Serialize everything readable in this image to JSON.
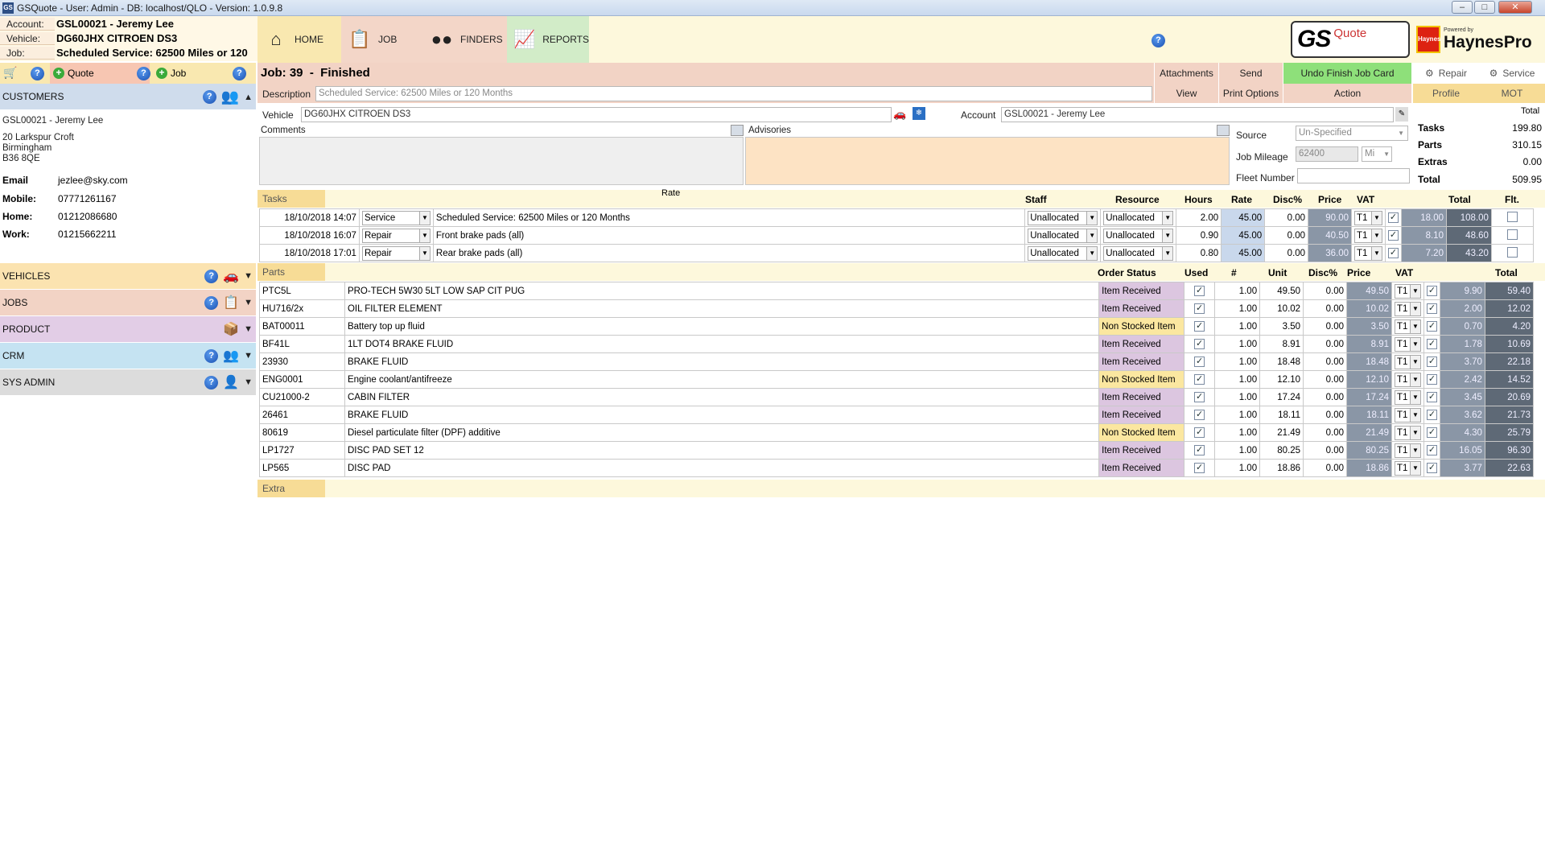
{
  "window": {
    "title": "GSQuote - User: Admin - DB: localhost/QLO - Version: 1.0.9.8"
  },
  "info": {
    "account_label": "Account:",
    "account_value": "GSL00021 - Jeremy Lee",
    "vehicle_label": "Vehicle:",
    "vehicle_value": "DG60JHX CITROEN DS3",
    "job_label": "Job:",
    "job_value": "Scheduled Service: 62500 Miles or 120"
  },
  "nav": {
    "home": "HOME",
    "job": "JOB",
    "finders": "FINDERS",
    "reports": "REPORTS"
  },
  "brand": {
    "gs": "GS",
    "quote": "Quote",
    "powered": "Powered by",
    "haynes": "HaynesPro",
    "haynes_logo": "Haynes"
  },
  "toolbar": {
    "quote": "Quote",
    "job": "Job"
  },
  "sidebar": {
    "customers": "CUSTOMERS",
    "vehicles": "VEHICLES",
    "jobs": "JOBS",
    "product": "PRODUCT",
    "crm": "CRM",
    "sysadmin": "SYS ADMIN"
  },
  "customer": {
    "name": "GSL00021 - Jeremy Lee",
    "addr1": "20 Larkspur Croft",
    "addr2": "Birmingham",
    "addr3": "B36 8QE",
    "email_label": "Email",
    "email": "jezlee@sky.com",
    "mobile_label": "Mobile:",
    "mobile": "07771261167",
    "home_label": "Home:",
    "home": "01212086680",
    "work_label": "Work:",
    "work": "01215662211"
  },
  "job": {
    "title": "Job: 39  -  Finished",
    "attachments": "Attachments",
    "send": "Send",
    "undo": "Undo Finish Job Card",
    "view": "View",
    "print_options": "Print Options",
    "action": "Action",
    "repair": "Repair",
    "service": "Service",
    "profile": "Profile",
    "mot": "MOT",
    "description_label": "Description",
    "description": "Scheduled Service: 62500 Miles or 120 Months",
    "vehicle_label": "Vehicle",
    "vehicle": "DG60JHX CITROEN DS3",
    "account_label": "Account",
    "account": "GSL00021 - Jeremy Lee",
    "comments_label": "Comments",
    "advisories_label": "Advisories",
    "source_label": "Source",
    "source": "Un-Specified",
    "mileage_label": "Job Mileage",
    "mileage": "62400",
    "mileage_unit": "Mi",
    "fleet_label": "Fleet Number",
    "fleet": ""
  },
  "totals": {
    "header": "Total",
    "tasks_label": "Tasks",
    "tasks": "199.80",
    "parts_label": "Parts",
    "parts": "310.15",
    "extras_label": "Extras",
    "extras": "0.00",
    "total_label": "Total",
    "total": "509.95"
  },
  "tasks": {
    "section": "Tasks",
    "rate_top": "Rate",
    "headers": {
      "staff": "Staff",
      "resource": "Resource",
      "hours": "Hours",
      "rate": "Rate",
      "disc": "Disc%",
      "price": "Price",
      "vat": "VAT",
      "total": "Total",
      "flt": "Flt."
    },
    "rows": [
      {
        "date": "18/10/2018 14:07",
        "type": "Service",
        "desc": "Scheduled Service: 62500 Miles or 120 Months",
        "staff": "Unallocated",
        "resource": "Unallocated",
        "hours": "2.00",
        "rate": "45.00",
        "disc": "0.00",
        "price": "90.00",
        "vat": "T1",
        "vatamt": "18.00",
        "total": "108.00"
      },
      {
        "date": "18/10/2018 16:07",
        "type": "Repair",
        "desc": "Front brake pads (all)",
        "staff": "Unallocated",
        "resource": "Unallocated",
        "hours": "0.90",
        "rate": "45.00",
        "disc": "0.00",
        "price": "40.50",
        "vat": "T1",
        "vatamt": "8.10",
        "total": "48.60"
      },
      {
        "date": "18/10/2018 17:01",
        "type": "Repair",
        "desc": "Rear brake pads (all)",
        "staff": "Unallocated",
        "resource": "Unallocated",
        "hours": "0.80",
        "rate": "45.00",
        "disc": "0.00",
        "price": "36.00",
        "vat": "T1",
        "vatamt": "7.20",
        "total": "43.20"
      }
    ]
  },
  "parts": {
    "section": "Parts",
    "headers": {
      "status": "Order Status",
      "used": "Used",
      "qty": "#",
      "unit": "Unit",
      "disc": "Disc%",
      "price": "Price",
      "vat": "VAT",
      "total": "Total"
    },
    "rows": [
      {
        "code": "PTC5L",
        "desc": "PRO-TECH 5W30 5LT LOW SAP CIT  PUG",
        "status": "Item Received",
        "qty": "1.00",
        "unit": "49.50",
        "disc": "0.00",
        "price": "49.50",
        "vat": "T1",
        "vatamt": "9.90",
        "total": "59.40"
      },
      {
        "code": "HU716/2x",
        "desc": "OIL FILTER ELEMENT",
        "status": "Item Received",
        "qty": "1.00",
        "unit": "10.02",
        "disc": "0.00",
        "price": "10.02",
        "vat": "T1",
        "vatamt": "2.00",
        "total": "12.02"
      },
      {
        "code": "BAT00011",
        "desc": "Battery top up fluid",
        "status": "Non Stocked Item",
        "qty": "1.00",
        "unit": "3.50",
        "disc": "0.00",
        "price": "3.50",
        "vat": "T1",
        "vatamt": "0.70",
        "total": "4.20"
      },
      {
        "code": "BF41L",
        "desc": "1LT DOT4 BRAKE FLUID",
        "status": "Item Received",
        "qty": "1.00",
        "unit": "8.91",
        "disc": "0.00",
        "price": "8.91",
        "vat": "T1",
        "vatamt": "1.78",
        "total": "10.69"
      },
      {
        "code": "23930",
        "desc": "BRAKE FLUID",
        "status": "Item Received",
        "qty": "1.00",
        "unit": "18.48",
        "disc": "0.00",
        "price": "18.48",
        "vat": "T1",
        "vatamt": "3.70",
        "total": "22.18"
      },
      {
        "code": "ENG0001",
        "desc": "Engine coolant/antifreeze",
        "status": "Non Stocked Item",
        "qty": "1.00",
        "unit": "12.10",
        "disc": "0.00",
        "price": "12.10",
        "vat": "T1",
        "vatamt": "2.42",
        "total": "14.52"
      },
      {
        "code": "CU21000-2",
        "desc": "CABIN FILTER",
        "status": "Item Received",
        "qty": "1.00",
        "unit": "17.24",
        "disc": "0.00",
        "price": "17.24",
        "vat": "T1",
        "vatamt": "3.45",
        "total": "20.69"
      },
      {
        "code": "26461",
        "desc": "BRAKE FLUID",
        "status": "Item Received",
        "qty": "1.00",
        "unit": "18.11",
        "disc": "0.00",
        "price": "18.11",
        "vat": "T1",
        "vatamt": "3.62",
        "total": "21.73"
      },
      {
        "code": "80619",
        "desc": "Diesel particulate filter (DPF) additive",
        "status": "Non Stocked Item",
        "qty": "1.00",
        "unit": "21.49",
        "disc": "0.00",
        "price": "21.49",
        "vat": "T1",
        "vatamt": "4.30",
        "total": "25.79"
      },
      {
        "code": "LP1727",
        "desc": "DISC PAD SET 12",
        "status": "Item Received",
        "qty": "1.00",
        "unit": "80.25",
        "disc": "0.00",
        "price": "80.25",
        "vat": "T1",
        "vatamt": "16.05",
        "total": "96.30"
      },
      {
        "code": "LP565",
        "desc": "DISC PAD",
        "status": "Item Received",
        "qty": "1.00",
        "unit": "18.86",
        "disc": "0.00",
        "price": "18.86",
        "vat": "T1",
        "vatamt": "3.77",
        "total": "22.63"
      }
    ]
  },
  "extra": {
    "section": "Extra"
  },
  "colors": {
    "customers": "#cfdcec",
    "vehicles": "#fbe3b0",
    "jobs": "#f2d3c5",
    "product": "#e2cde6",
    "crm": "#c5e3f2",
    "sysadmin": "#dcdcdc",
    "nav_job": "#f3d6c8",
    "nav_finders": "#f3d6c8",
    "nav_reports": "#d2ecc8"
  }
}
